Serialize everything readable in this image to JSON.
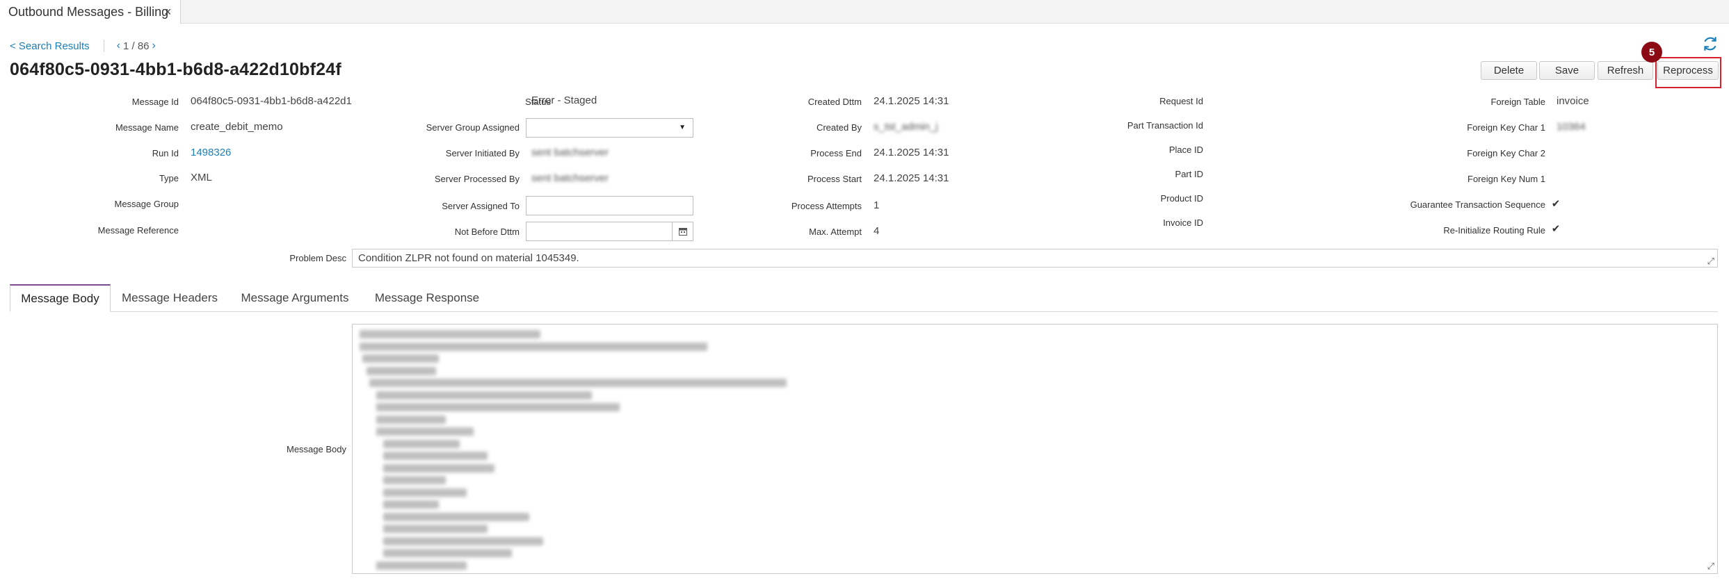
{
  "tab": {
    "title": "Outbound Messages - Billing",
    "close": "×"
  },
  "nav": {
    "back": "< Search Results",
    "prev": "‹",
    "next": "›",
    "pager": "1 / 86"
  },
  "record_title": "064f80c5-0931-4bb1-b6d8-a422d10bf24f",
  "toolbar": {
    "delete": "Delete",
    "save": "Save",
    "refresh": "Refresh",
    "reprocess": "Reprocess",
    "step_badge": "5"
  },
  "fields": {
    "message_id": {
      "label": "Message Id",
      "value": "064f80c5-0931-4bb1-b6d8-a422d1"
    },
    "message_name": {
      "label": "Message Name",
      "value": "create_debit_memo"
    },
    "run_id": {
      "label": "Run Id",
      "value": "1498326"
    },
    "type": {
      "label": "Type",
      "value": "XML"
    },
    "message_group": {
      "label": "Message Group",
      "value": ""
    },
    "message_reference": {
      "label": "Message Reference",
      "value": ""
    },
    "status": {
      "label": "Status",
      "value": "Error - Staged"
    },
    "server_group_assigned": {
      "label": "Server Group Assigned",
      "value": ""
    },
    "server_initiated_by": {
      "label": "Server Initiated By",
      "value": "sent batchserver"
    },
    "server_processed_by": {
      "label": "Server Processed By",
      "value": "sent batchserver"
    },
    "server_assigned_to": {
      "label": "Server Assigned To",
      "value": ""
    },
    "not_before_dttm": {
      "label": "Not Before Dttm",
      "value": ""
    },
    "created_dttm": {
      "label": "Created Dttm",
      "value": "24.1.2025 14:31"
    },
    "created_by": {
      "label": "Created By",
      "value": "s_tst_admin_j"
    },
    "process_end": {
      "label": "Process End",
      "value": "24.1.2025 14:31"
    },
    "process_start": {
      "label": "Process Start",
      "value": "24.1.2025 14:31"
    },
    "process_attempts": {
      "label": "Process Attempts",
      "value": "1"
    },
    "max_attempt": {
      "label": "Max. Attempt",
      "value": "4"
    },
    "request_id": {
      "label": "Request Id",
      "value": ""
    },
    "part_transaction_id": {
      "label": "Part Transaction Id",
      "value": ""
    },
    "place_id": {
      "label": "Place ID",
      "value": ""
    },
    "part_id": {
      "label": "Part ID",
      "value": ""
    },
    "product_id": {
      "label": "Product ID",
      "value": ""
    },
    "invoice_id": {
      "label": "Invoice ID",
      "value": ""
    },
    "foreign_table": {
      "label": "Foreign Table",
      "value": "invoice"
    },
    "foreign_key_char_1": {
      "label": "Foreign Key Char 1",
      "value": "10364"
    },
    "foreign_key_char_2": {
      "label": "Foreign Key Char 2",
      "value": ""
    },
    "foreign_key_num_1": {
      "label": "Foreign Key Num 1",
      "value": ""
    },
    "guarantee_transaction_sequence": {
      "label": "Guarantee Transaction Sequence",
      "checked": true
    },
    "reinitialize_routing_rule": {
      "label": "Re-Initialize Routing Rule",
      "checked": true
    },
    "problem_desc": {
      "label": "Problem Desc",
      "value": "Condition ZLPR not found on material 1045349."
    }
  },
  "tabs": [
    "Message Body",
    "Message Headers",
    "Message Arguments",
    "Message Response"
  ],
  "message_body_label": "Message Body",
  "icons": {
    "refresh": "refresh-icon",
    "calendar": "calendar-icon",
    "dropdown": "chevron-down-icon",
    "check": "✔",
    "resize": "⤢"
  },
  "colors": {
    "link": "#1b7fb8",
    "highlight": "#d5202e",
    "badge": "#8b0a14",
    "active_tab": "#7a4a8c"
  }
}
